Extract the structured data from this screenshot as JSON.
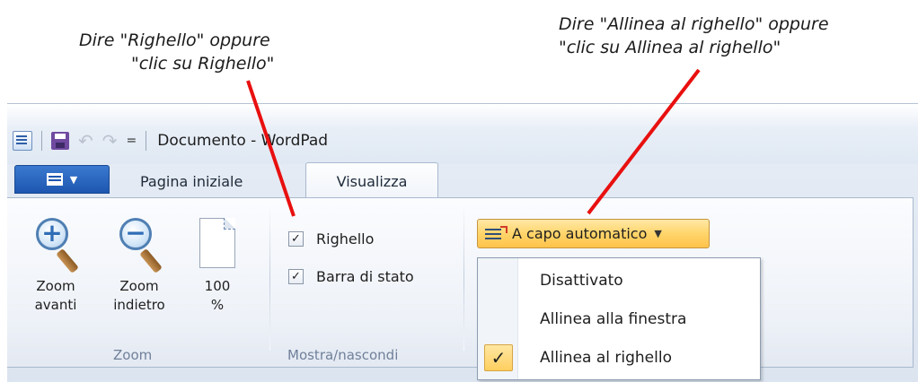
{
  "annotations": {
    "left_line1": "Dire \"Righello\" oppure",
    "left_line2": "\"clic su Righello\"",
    "right_line1": "Dire \"Allinea al righello\" oppure",
    "right_line2": "\"clic su Allinea al righello\""
  },
  "window": {
    "title": "Documento - WordPad",
    "qat_dropdown": "="
  },
  "tabs": {
    "home": "Pagina iniziale",
    "view": "Visualizza"
  },
  "ribbon": {
    "zoom": {
      "group_label": "Zoom",
      "zoom_in_line1": "Zoom",
      "zoom_in_line2": "avanti",
      "zoom_out_line1": "Zoom",
      "zoom_out_line2": "indietro",
      "hundred_line1": "100",
      "hundred_line2": "%"
    },
    "show_hide": {
      "group_label": "Mostra/nascondi",
      "ruler": "Righello",
      "ruler_checked": true,
      "status_bar": "Barra di stato",
      "status_bar_checked": true
    },
    "wrap": {
      "button_label": "A capo automatico"
    }
  },
  "wrap_menu": {
    "items": [
      {
        "label": "Disattivato",
        "checked": false
      },
      {
        "label": "Allinea alla finestra",
        "checked": false
      },
      {
        "label": "Allinea al righello",
        "checked": true
      }
    ]
  },
  "colors": {
    "pointer": "#e8100f",
    "accent_orange": "#ffc34a",
    "file_tab_blue": "#1d56b0"
  }
}
